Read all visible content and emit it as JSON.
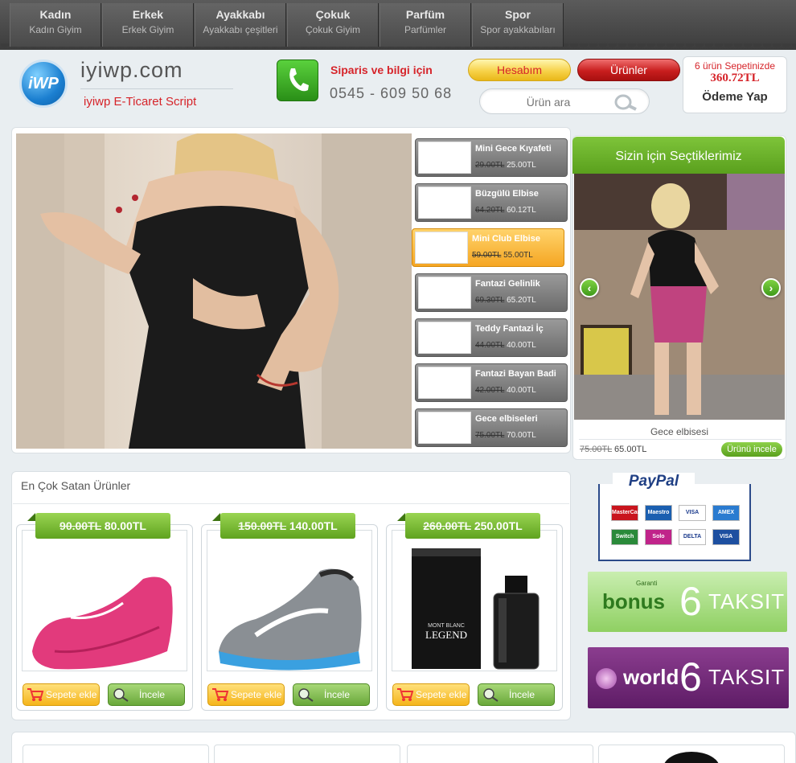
{
  "nav": [
    {
      "title": "Kadın",
      "sub": "Kadın Giyim"
    },
    {
      "title": "Erkek",
      "sub": "Erkek Giyim"
    },
    {
      "title": "Ayakkabı",
      "sub": "Ayakkabı çeşitleri"
    },
    {
      "title": "Çokuk",
      "sub": "Çokuk Giyim"
    },
    {
      "title": "Parfüm",
      "sub": "Parfümler"
    },
    {
      "title": "Spor",
      "sub": "Spor ayakkabıları"
    }
  ],
  "header": {
    "logo_mark": "iWP",
    "site_name": "iyiwp.com",
    "tagline": "iyiwp E-Ticaret Script",
    "phone_label": "Siparis ve bilgi için",
    "phone_number": "0545 - 609 50 68",
    "account_button": "Hesabım",
    "products_button": "Ürünler",
    "search_placeholder": "Ürün ara",
    "cart_count_text": "6 ürün Sepetinizde",
    "cart_total": "360.72TL",
    "checkout_label": "Ödeme Yap"
  },
  "slider": {
    "items": [
      {
        "name": "Mini Gece Kıyafeti",
        "old_price": "29.00TL",
        "price": "25.00TL",
        "active": false
      },
      {
        "name": "Büzgülü Elbise",
        "old_price": "64.20TL",
        "price": "60.12TL",
        "active": false
      },
      {
        "name": "Mini Club Elbise",
        "old_price": "59.00TL",
        "price": "55.00TL",
        "active": true
      },
      {
        "name": "Fantazi Gelinlik",
        "old_price": "69.30TL",
        "price": "65.20TL",
        "active": false
      },
      {
        "name": "Teddy Fantazi İç",
        "old_price": "44.00TL",
        "price": "40.00TL",
        "active": false
      },
      {
        "name": "Fantazi Bayan Badi",
        "old_price": "42.00TL",
        "price": "40.00TL",
        "active": false
      },
      {
        "name": "Gece elbiseleri",
        "old_price": "75.00TL",
        "price": "70.00TL",
        "active": false
      }
    ]
  },
  "featured": {
    "title": "Sizin için Seçtiklerimiz",
    "product_name": "Gece elbisesi",
    "old_price": "75.00TL",
    "price": "65.00TL",
    "button": "Ürünü incele"
  },
  "best_sellers": {
    "title": "En Çok Satan Ürünler",
    "products": [
      {
        "old_price": "90.00TL",
        "price": "80.00TL",
        "cart_label": "Sepete ekle",
        "view_label": "İncele"
      },
      {
        "old_price": "150.00TL",
        "price": "140.00TL",
        "cart_label": "Sepete ekle",
        "view_label": "İncele"
      },
      {
        "old_price": "260.00TL",
        "price": "250.00TL",
        "cart_label": "Sepete ekle",
        "view_label": "İncele"
      }
    ],
    "perfume_brand": "MONT BLANC",
    "perfume_name": "LEGEND"
  },
  "ads": {
    "paypal_logo": "PayPal",
    "cards": [
      "MasterCard",
      "Maestro",
      "VISA",
      "AMEX",
      "Switch",
      "Solo",
      "DELTA",
      "VISA Electron"
    ],
    "bonus_brand": "bonus",
    "bonus_small": "Garanti",
    "world_brand": "world",
    "installments_num": "6",
    "installments_word": "TAKSIT"
  }
}
